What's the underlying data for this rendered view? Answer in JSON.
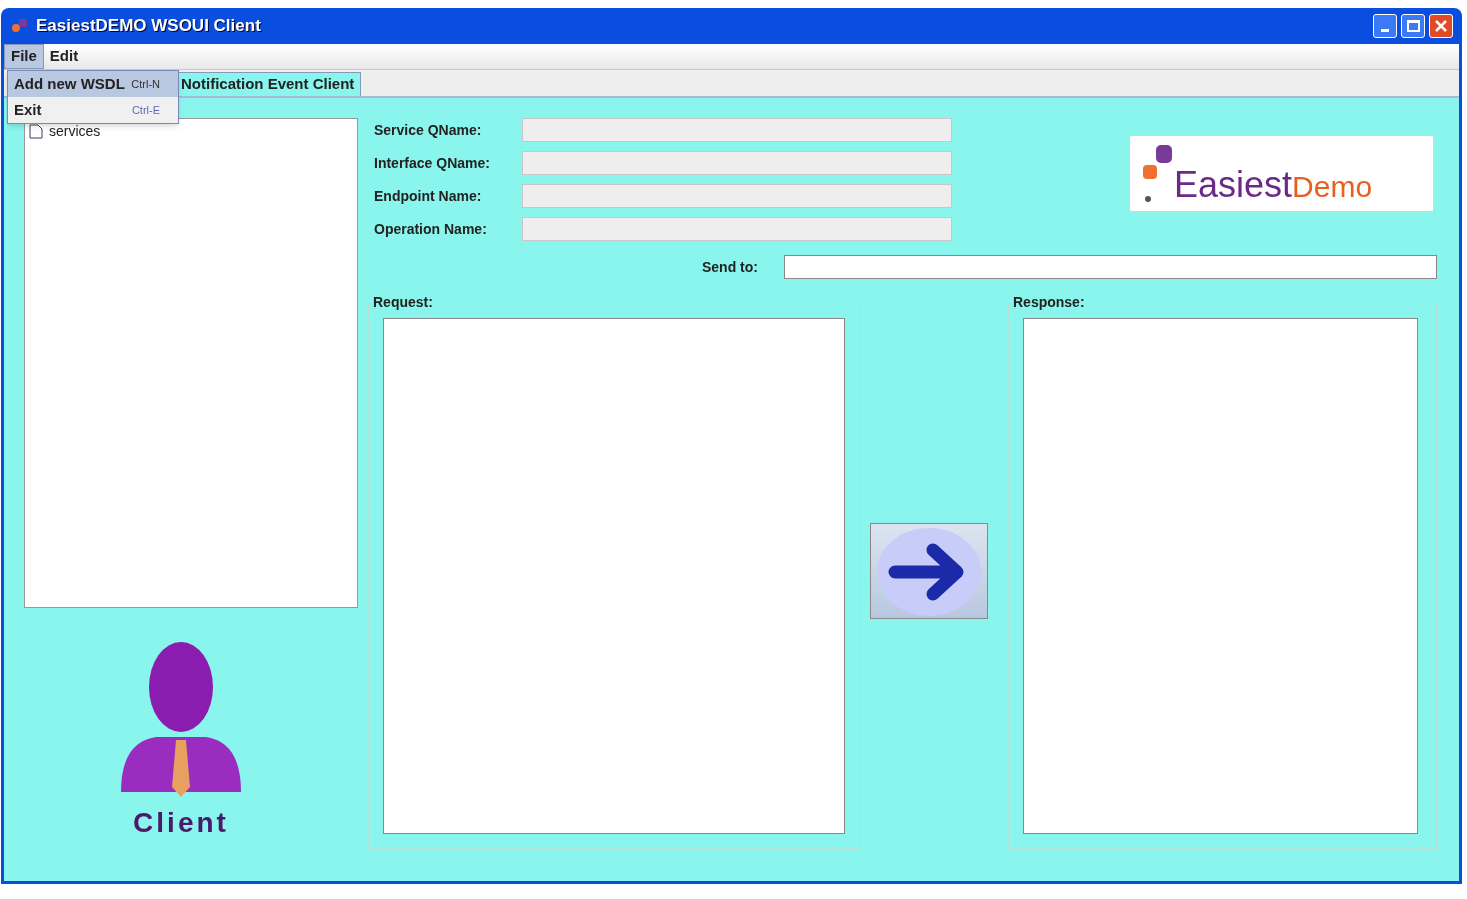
{
  "window": {
    "title": "EasiestDEMO WSOUI Client"
  },
  "menu_bar": [
    {
      "label": "File",
      "selected": true
    },
    {
      "label": "Edit",
      "selected": false
    }
  ],
  "open_menu": [
    {
      "label": "Add new WSDL",
      "shortcut": "Ctrl-N",
      "selected": true
    },
    {
      "label": "Exit",
      "shortcut": "Ctrl-E",
      "selected": false
    }
  ],
  "tabs": [
    {
      "label": "Notification Event Client",
      "selected": true
    }
  ],
  "tree": {
    "root": {
      "label": "services"
    }
  },
  "fields": [
    {
      "label": "Service QName:"
    },
    {
      "label": "Interface QName:"
    },
    {
      "label": "Endpoint Name:"
    },
    {
      "label": "Operation Name:"
    }
  ],
  "logo": {
    "part_1": "Easiest",
    "part_2": "Demo"
  },
  "send_to": {
    "label": "Send to:"
  },
  "request": {
    "title": "Request:"
  },
  "response": {
    "title": "Response:"
  },
  "client_badge": {
    "caption": "Client"
  }
}
